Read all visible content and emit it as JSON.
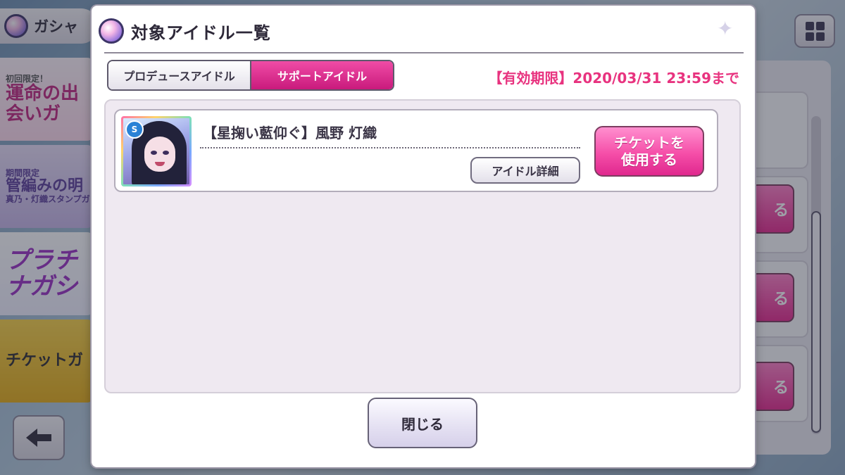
{
  "background": {
    "header_title": "ガシャ",
    "banners": [
      {
        "top": "初回限定！",
        "main": "運命の出会いガ"
      },
      {
        "top": "期間限定",
        "main": "管編みの明",
        "sub": "真乃・灯織スタンプガ"
      },
      {
        "main": "プラチナガシ"
      },
      {
        "main": "チケットガ"
      }
    ],
    "right_buttons": [
      "る",
      "る",
      "る"
    ]
  },
  "modal": {
    "title": "対象アイドル一覧",
    "tabs": [
      {
        "label": "プロデュースアイドル",
        "active": false
      },
      {
        "label": "サポートアイドル",
        "active": true
      }
    ],
    "expiry": "【有効期限】2020/03/31 23:59まで",
    "idols": [
      {
        "rarity": "S",
        "name": "【星掬い藍仰ぐ】風野 灯織",
        "detail_label": "アイドル詳細",
        "use_label_line1": "チケットを",
        "use_label_line2": "使用する"
      }
    ],
    "close_label": "閉じる"
  },
  "colors": {
    "accent_pink": "#e8337f",
    "active_tab": "#d8278a"
  }
}
